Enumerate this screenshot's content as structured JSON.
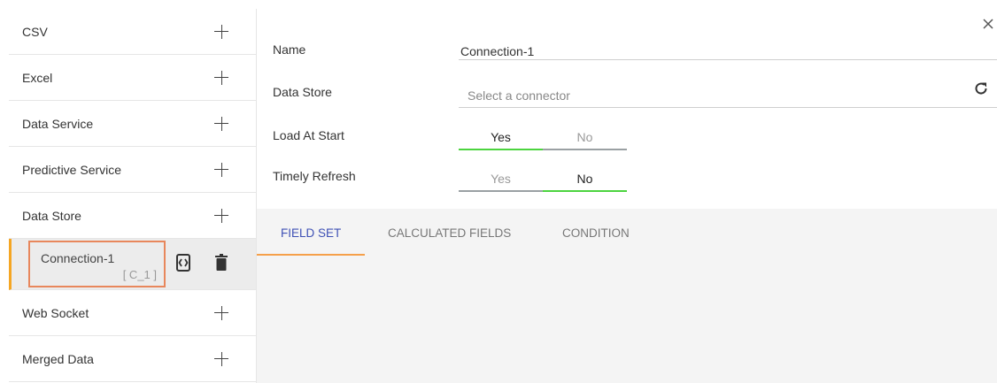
{
  "sidebar": {
    "items": [
      {
        "label": "CSV"
      },
      {
        "label": "Excel"
      },
      {
        "label": "Data Service"
      },
      {
        "label": "Predictive Service"
      },
      {
        "label": "Data Store"
      },
      {
        "label": "Web Socket"
      },
      {
        "label": "Merged Data"
      }
    ],
    "connection": {
      "name": "Connection-1",
      "code": "[ C_1 ]"
    }
  },
  "form": {
    "name_label": "Name",
    "name_value": "Connection-1",
    "data_store_label": "Data Store",
    "data_store_placeholder": "Select a connector",
    "load_at_start_label": "Load At Start",
    "load_at_start": {
      "yes": "Yes",
      "no": "No",
      "selected": "Yes"
    },
    "timely_refresh_label": "Timely Refresh",
    "timely_refresh": {
      "yes": "Yes",
      "no": "No",
      "selected": "No"
    }
  },
  "tabs": [
    {
      "label": "FIELD SET",
      "active": true
    },
    {
      "label": "CALCULATED FIELDS",
      "active": false
    },
    {
      "label": "CONDITION",
      "active": false
    }
  ],
  "colors": {
    "accent_orange": "#f5a623",
    "highlight_box": "#e8875c",
    "toggle_active": "#4cd43f",
    "tab_active": "#3f51b5"
  }
}
